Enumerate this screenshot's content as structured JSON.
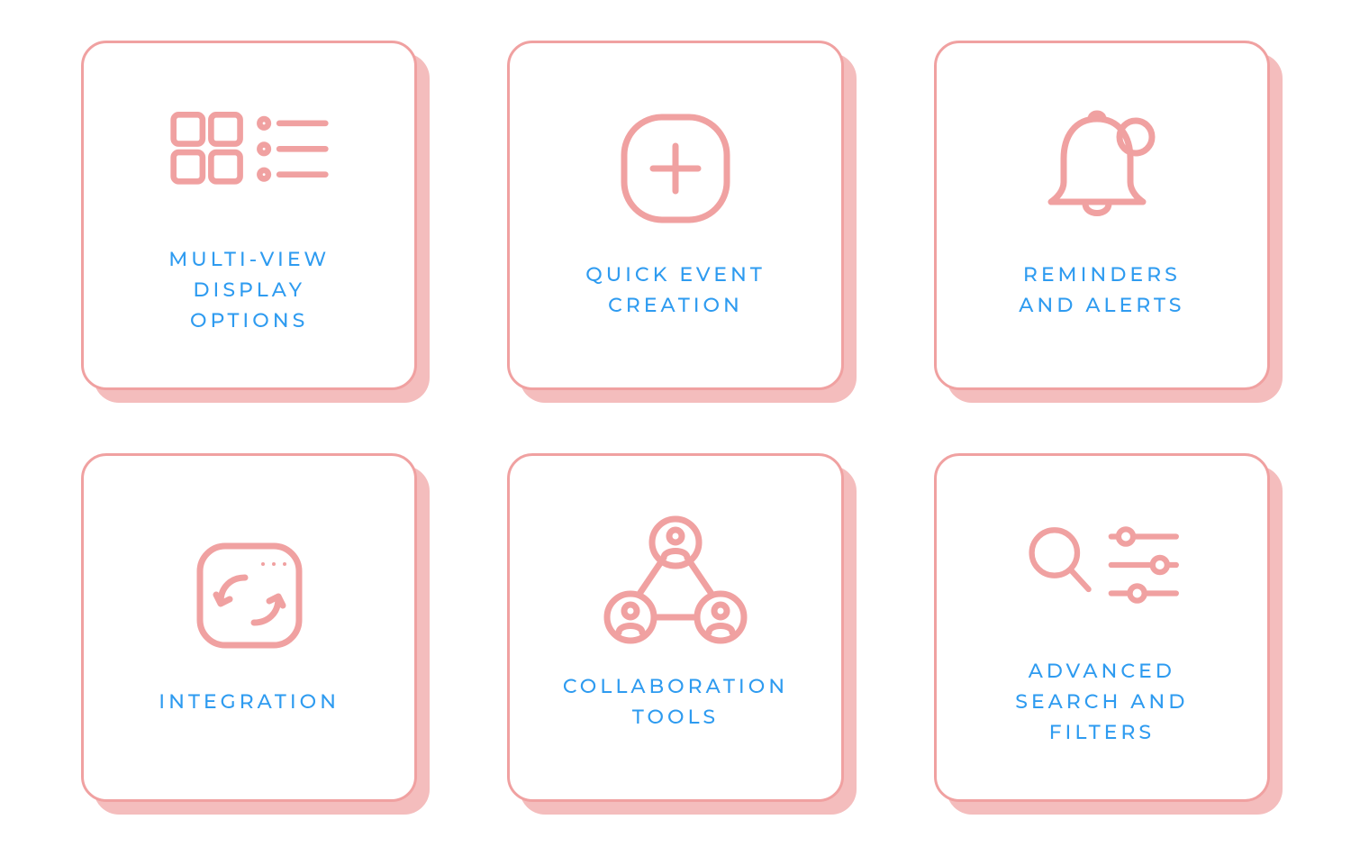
{
  "colors": {
    "pink": "#F0A1A1",
    "pink_shadow": "#F4BDBD",
    "blue": "#2E9BF0"
  },
  "cards": [
    {
      "icon": "grid-list-icon",
      "label": "MULTI-VIEW\nDISPLAY\nOPTIONS"
    },
    {
      "icon": "plus-squircle-icon",
      "label": "QUICK EVENT\nCREATION"
    },
    {
      "icon": "bell-badge-icon",
      "label": "REMINDERS\nAND ALERTS"
    },
    {
      "icon": "sync-box-icon",
      "label": "INTEGRATION"
    },
    {
      "icon": "people-network-icon",
      "label": "COLLABORATION\nTOOLS"
    },
    {
      "icon": "search-sliders-icon",
      "label": "ADVANCED\nSEARCH AND\nFILTERS"
    }
  ]
}
